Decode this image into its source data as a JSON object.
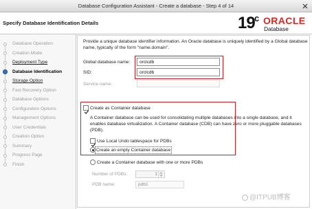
{
  "window": {
    "title": "Database Configuration Assistant - Create a database - Step 4 of 14",
    "close_icon": "close-icon"
  },
  "header": {
    "title": "Specify Database Identification Details",
    "logo": {
      "version": "19",
      "version_suffix": "c",
      "brand": "ORACLE",
      "product": "Database"
    }
  },
  "sidebar": {
    "items": [
      {
        "label": "Database Operation",
        "current": false,
        "link": false
      },
      {
        "label": "Creation Mode",
        "current": false,
        "link": false
      },
      {
        "label": "Deployment Type",
        "current": false,
        "link": true
      },
      {
        "label": "Database Identification",
        "current": true,
        "link": false
      },
      {
        "label": "Storage Option",
        "current": false,
        "link": true
      },
      {
        "label": "Fast Recovery Option",
        "current": false,
        "link": false
      },
      {
        "label": "Database Options",
        "current": false,
        "link": false
      },
      {
        "label": "Configuration Options",
        "current": false,
        "link": false
      },
      {
        "label": "Management Options",
        "current": false,
        "link": false
      },
      {
        "label": "User Credentials",
        "current": false,
        "link": false
      },
      {
        "label": "Creation Option",
        "current": false,
        "link": false
      },
      {
        "label": "Summary",
        "current": false,
        "link": false
      },
      {
        "label": "Progress Page",
        "current": false,
        "link": false
      },
      {
        "label": "Finish",
        "current": false,
        "link": false
      }
    ]
  },
  "main": {
    "intro": "Provide a unique database identifier information. An Oracle database is uniquely identified by a Global database name, typically of the form \"name.domain\".",
    "global_database_name": {
      "label": "Global database name:",
      "value": "orclcdb"
    },
    "sid": {
      "label": "SID:",
      "value": "orclcdb"
    },
    "service_name": {
      "label": "Service name:",
      "enabled": false
    },
    "container": {
      "label": "Create as Container database",
      "checked": true,
      "description": "A Container database can be used for consolidating multiple databases into a single database, and it enables database virtualization. A Container database (CDB) can have zero or more pluggable databases (PDB).",
      "local_undo": {
        "label": "Use Local Undo tablespace for PDBs",
        "checked": true
      },
      "options": [
        {
          "label": "Create an empty Container database",
          "selected": true
        },
        {
          "label": "Create a Container database with one or more PDBs",
          "selected": false
        }
      ],
      "pdb_count": {
        "label": "Number of PDBs:",
        "value": "1",
        "enabled": false
      },
      "pdb_name": {
        "label": "PDB name:",
        "value": "pdb1",
        "enabled": false
      }
    }
  },
  "watermark": {
    "text": "@ITPUB博客",
    "icon": "itpub-logo-icon"
  },
  "colors": {
    "highlight_box": "#e3141b",
    "oracle_red": "#e0261f",
    "current_step": "#3a72b8",
    "disabled_text": "#9c9c9c"
  }
}
